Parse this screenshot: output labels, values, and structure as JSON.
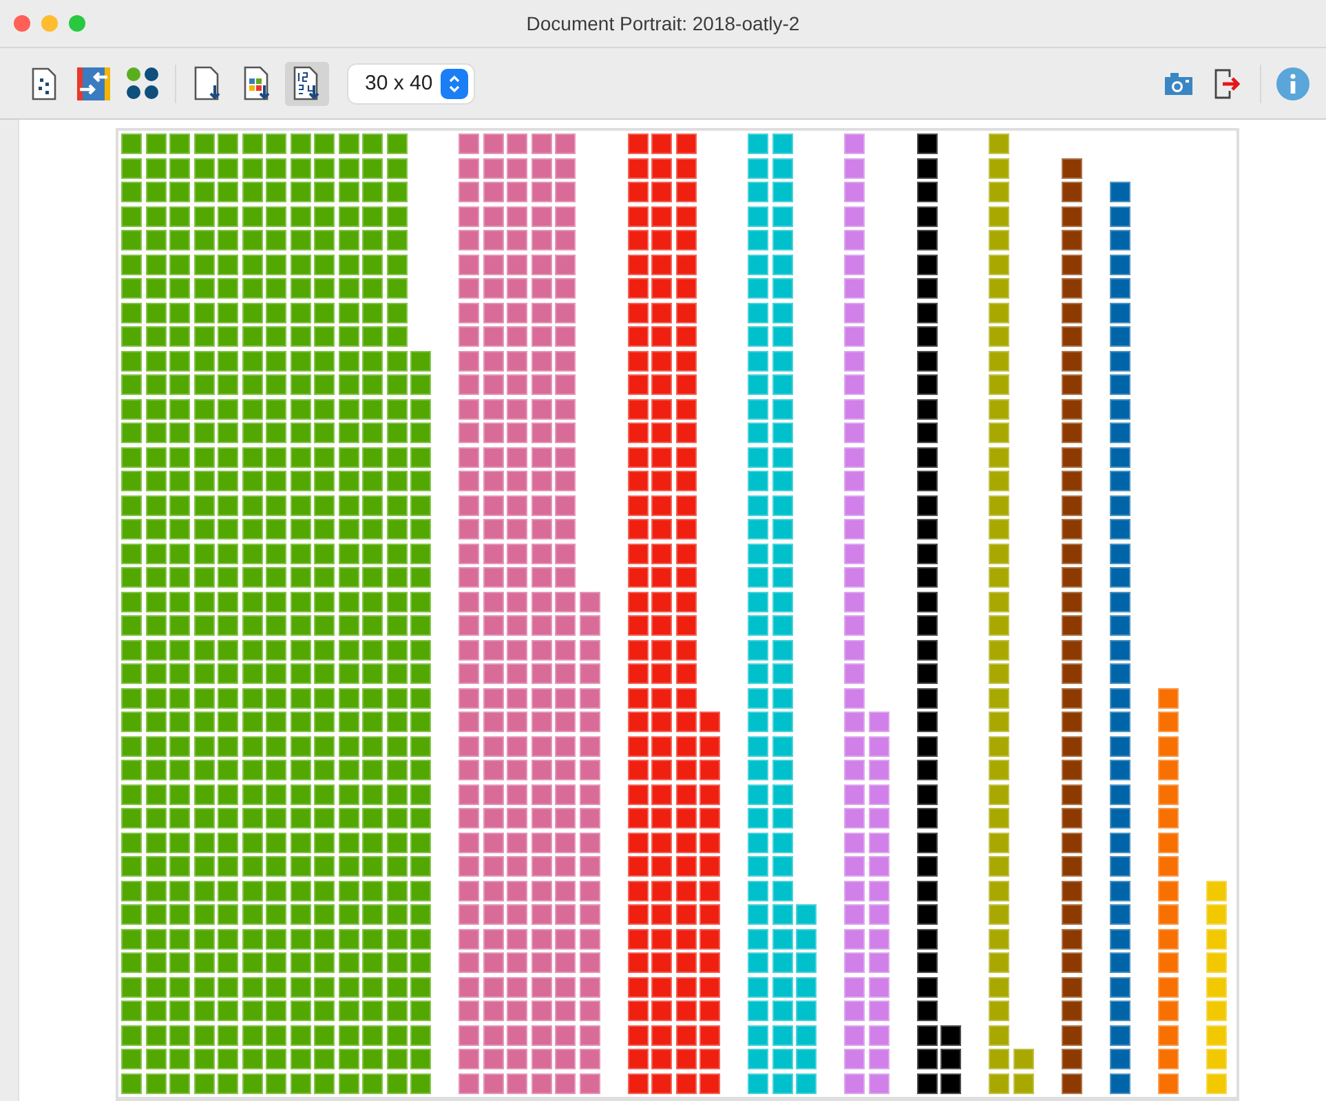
{
  "window": {
    "title": "Document Portrait: 2018-oatly-2"
  },
  "toolbar": {
    "size_select": {
      "value": "30 x 40"
    }
  },
  "portrait": {
    "groups": [
      {
        "color": "#52a800"
      },
      {
        "color": "#d96b99"
      },
      {
        "color": "#f02010"
      },
      {
        "color": "#00c0cc"
      },
      {
        "color": "#d080e8"
      },
      {
        "color": "#000000"
      },
      {
        "color": "#a8a800"
      },
      {
        "color": "#8c3a00"
      },
      {
        "color": "#0065a8"
      },
      {
        "color": "#f87000"
      },
      {
        "color": "#f2c800"
      }
    ]
  }
}
